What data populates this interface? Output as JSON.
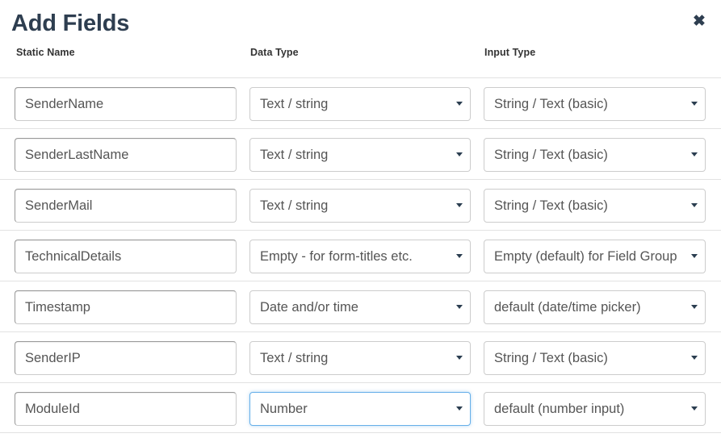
{
  "modal": {
    "title": "Add Fields",
    "close_label": "✖"
  },
  "columns": {
    "static_name": "Static Name",
    "data_type": "Data Type",
    "input_type": "Input Type"
  },
  "colors": {
    "title": "#2e3e50",
    "focus_border": "#66afe9",
    "row_divider": "#e2e2e2",
    "text": "#555555"
  },
  "rows": [
    {
      "static_name": "SenderName",
      "data_type": "Text / string",
      "input_type": "String / Text (basic)",
      "data_type_focused": false
    },
    {
      "static_name": "SenderLastName",
      "data_type": "Text / string",
      "input_type": "String / Text (basic)",
      "data_type_focused": false
    },
    {
      "static_name": "SenderMail",
      "data_type": "Text / string",
      "input_type": "String / Text (basic)",
      "data_type_focused": false
    },
    {
      "static_name": "TechnicalDetails",
      "data_type": "Empty - for form-titles etc.",
      "input_type": "Empty (default) for Field Group",
      "data_type_focused": false
    },
    {
      "static_name": "Timestamp",
      "data_type": "Date and/or time",
      "input_type": "default (date/time picker)",
      "data_type_focused": false
    },
    {
      "static_name": "SenderIP",
      "data_type": "Text / string",
      "input_type": "String / Text (basic)",
      "data_type_focused": false
    },
    {
      "static_name": "ModuleId",
      "data_type": "Number",
      "input_type": "default (number input)",
      "data_type_focused": true
    }
  ]
}
